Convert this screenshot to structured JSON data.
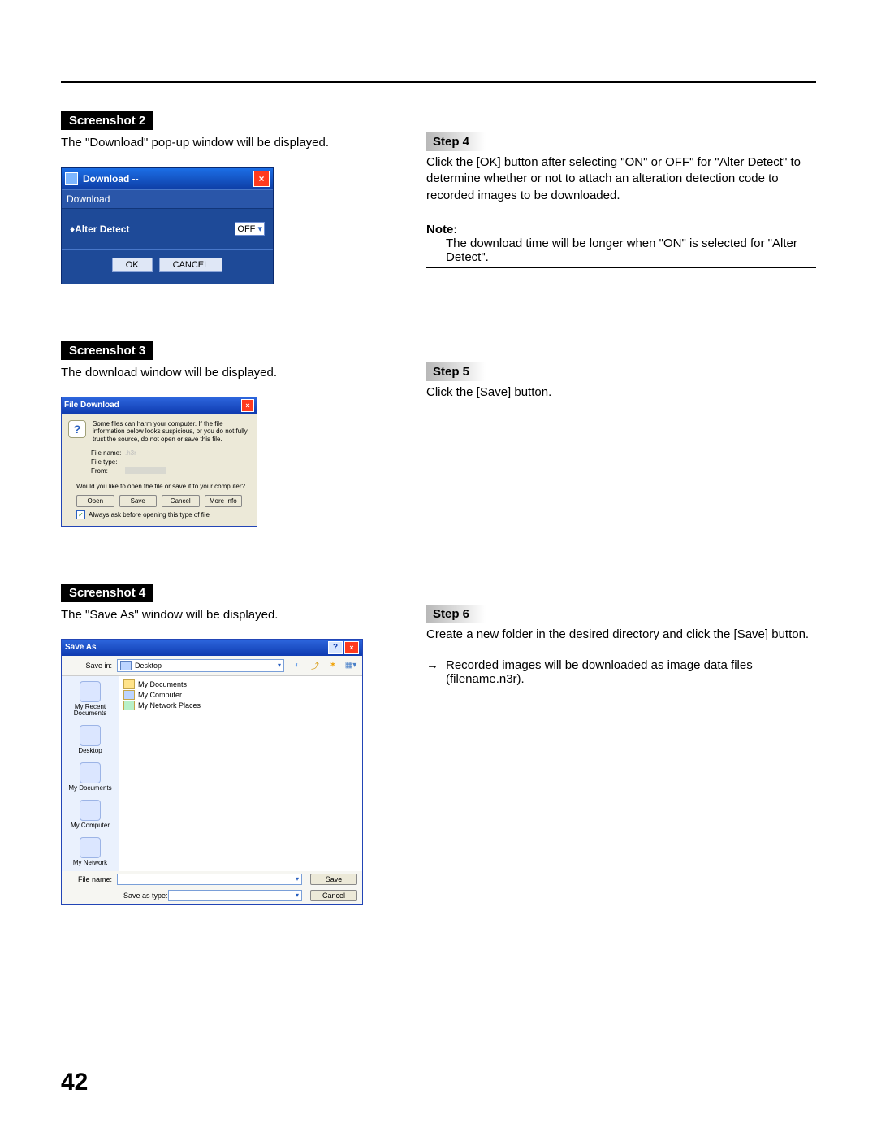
{
  "page_number": "42",
  "sections": {
    "s2": {
      "tag": "Screenshot 2",
      "desc": "The \"Download\" pop-up window will be displayed.",
      "step_tag": "Step 4",
      "step_body": "Click the [OK] button after selecting \"ON\" or OFF\" for \"Alter Detect\" to determine whether or not to attach an alteration detection code to recorded images to be downloaded.",
      "note_head": "Note:",
      "note_body": "The download time will be longer when \"ON\" is selected for \"Alter Detect\"."
    },
    "s3": {
      "tag": "Screenshot 3",
      "desc": "The download window will be displayed.",
      "step_tag": "Step 5",
      "step_body": "Click the [Save] button."
    },
    "s4": {
      "tag": "Screenshot 4",
      "desc": "The \"Save As\" window will be displayed.",
      "step_tag": "Step 6",
      "step_body": "Create a new folder in the desired directory and click the [Save] button.",
      "arrow": "→",
      "arrow_body": "Recorded images will be downloaded as image data files (filename.n3r)."
    }
  },
  "download_popup": {
    "title": "Download --",
    "subtitle": "Download",
    "field_label": "♦Alter Detect",
    "select_value": "OFF",
    "ok": "OK",
    "cancel": "CANCEL"
  },
  "file_download": {
    "title": "File Download",
    "warn": "Some files can harm your computer. If the file information below looks suspicious, or you do not fully trust the source, do not open or save this file.",
    "filename_k": "File name:",
    "filename_v": ".h3r",
    "filetype_k": "File type:",
    "from_k": "From:",
    "question": "Would you like to open the file or save it to your computer?",
    "open": "Open",
    "save": "Save",
    "cancel": "Cancel",
    "more": "More Info",
    "always": "Always ask before opening this type of file"
  },
  "save_as": {
    "title": "Save As",
    "save_in_k": "Save in:",
    "save_in_v": "Desktop",
    "places": [
      "My Recent Documents",
      "Desktop",
      "My Documents",
      "My Computer",
      "My Network"
    ],
    "list": [
      "My Documents",
      "My Computer",
      "My Network Places"
    ],
    "filename_k": "File name:",
    "filetype_k": "Save as type:",
    "save": "Save",
    "cancel": "Cancel"
  }
}
